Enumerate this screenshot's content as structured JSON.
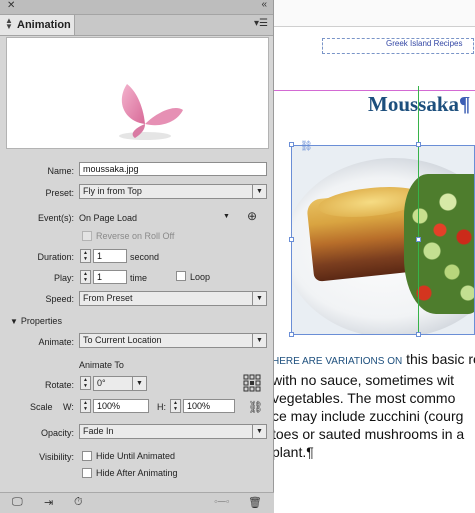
{
  "document": {
    "header_text": "Greek Island Recipes",
    "title": "Moussaka",
    "title_mark": "¶",
    "body_lines": [
      {
        "smallcaps": "HERE ARE VARIATIONS ON",
        "rest": " this basic re"
      },
      {
        "smallcaps": "",
        "rest": "with no sauce, sometimes wit"
      },
      {
        "smallcaps": "",
        "rest": "vegetables. The most commo"
      },
      {
        "smallcaps": "",
        "rest": "ce may include zucchini (courg"
      },
      {
        "smallcaps": "",
        "rest": "toes or sauted mushrooms in a"
      },
      {
        "smallcaps": "",
        "rest": "plant.¶"
      }
    ]
  },
  "panel": {
    "tab_label": "Animation",
    "name_label": "Name:",
    "name_value": "moussaka.jpg",
    "preset_label": "Preset:",
    "preset_value": "Fly in from Top",
    "events_label": "Event(s):",
    "events_value": "On Page Load",
    "reverse_label": "Reverse on Roll Off",
    "duration_label": "Duration:",
    "duration_value": "1",
    "duration_unit": "second",
    "play_label": "Play:",
    "play_value": "1",
    "play_unit": "time",
    "loop_label": "Loop",
    "speed_label": "Speed:",
    "speed_value": "From Preset",
    "properties_label": "Properties",
    "animate_label": "Animate:",
    "animate_value": "To Current Location",
    "animate_to_label": "Animate To",
    "rotate_label": "Rotate:",
    "rotate_value": "0°",
    "scale_label": "Scale",
    "scale_w_label": "W:",
    "scale_w_value": "100%",
    "scale_h_label": "H:",
    "scale_h_value": "100%",
    "opacity_label": "Opacity:",
    "opacity_value": "Fade In",
    "visibility_label": "Visibility:",
    "hide_until_label": "Hide Until Animated",
    "hide_after_label": "Hide After Animating"
  },
  "colors": {
    "title": "#1d4f7d",
    "frame": "#6a8ed6",
    "guide": "#37b34a",
    "panel_bg": "#d6d6d6"
  }
}
